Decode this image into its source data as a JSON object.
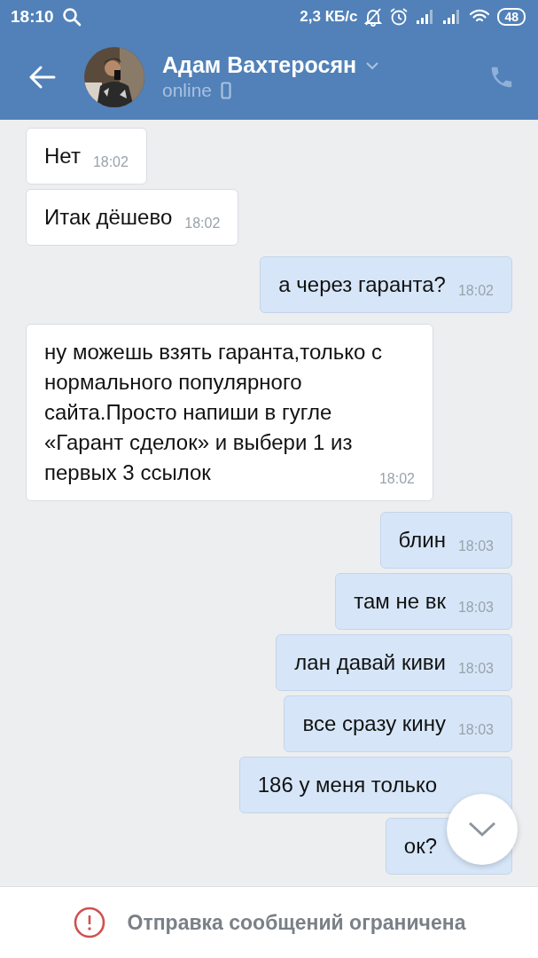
{
  "status_bar": {
    "time": "18:10",
    "speed": "2,3 КБ/с",
    "battery": "48"
  },
  "header": {
    "name": "Адам Вахтеросян",
    "status": "online"
  },
  "messages": [
    {
      "kind": "in",
      "text": "Нет",
      "time": "18:02"
    },
    {
      "kind": "in",
      "text": "Итак дёшево",
      "time": "18:02"
    },
    {
      "kind": "out",
      "text": "а через гаранта?",
      "time": "18:02"
    },
    {
      "kind": "in",
      "text": "ну можешь взять гаранта,только с нормального популярного сайта.Просто напиши в гугле «Гарант сделок» и выбери 1 из первых 3 ссылок",
      "time": "18:02"
    },
    {
      "kind": "out",
      "text": "блин",
      "time": "18:03"
    },
    {
      "kind": "out",
      "text": "там не вк",
      "time": "18:03"
    },
    {
      "kind": "out",
      "text": "лан давай киви",
      "time": "18:03"
    },
    {
      "kind": "out",
      "text": "все сразу кину",
      "time": "18:03"
    },
    {
      "kind": "out",
      "text": "186 у меня только"
    },
    {
      "kind": "out",
      "text": "ок?"
    }
  ],
  "notice": "Отправка сообщений ограничена"
}
